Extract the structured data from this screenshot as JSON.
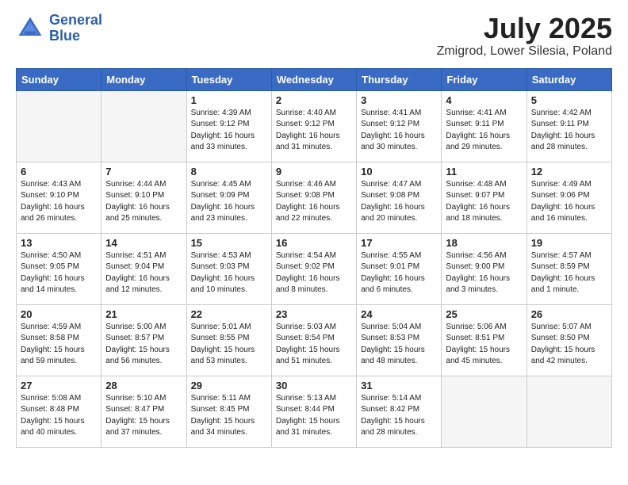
{
  "logo": {
    "text_general": "General",
    "text_blue": "Blue"
  },
  "title": "July 2025",
  "location": "Zmigrod, Lower Silesia, Poland",
  "weekdays": [
    "Sunday",
    "Monday",
    "Tuesday",
    "Wednesday",
    "Thursday",
    "Friday",
    "Saturday"
  ],
  "weeks": [
    [
      {
        "day": "",
        "info": ""
      },
      {
        "day": "",
        "info": ""
      },
      {
        "day": "1",
        "info": "Sunrise: 4:39 AM\nSunset: 9:12 PM\nDaylight: 16 hours\nand 33 minutes."
      },
      {
        "day": "2",
        "info": "Sunrise: 4:40 AM\nSunset: 9:12 PM\nDaylight: 16 hours\nand 31 minutes."
      },
      {
        "day": "3",
        "info": "Sunrise: 4:41 AM\nSunset: 9:12 PM\nDaylight: 16 hours\nand 30 minutes."
      },
      {
        "day": "4",
        "info": "Sunrise: 4:41 AM\nSunset: 9:11 PM\nDaylight: 16 hours\nand 29 minutes."
      },
      {
        "day": "5",
        "info": "Sunrise: 4:42 AM\nSunset: 9:11 PM\nDaylight: 16 hours\nand 28 minutes."
      }
    ],
    [
      {
        "day": "6",
        "info": "Sunrise: 4:43 AM\nSunset: 9:10 PM\nDaylight: 16 hours\nand 26 minutes."
      },
      {
        "day": "7",
        "info": "Sunrise: 4:44 AM\nSunset: 9:10 PM\nDaylight: 16 hours\nand 25 minutes."
      },
      {
        "day": "8",
        "info": "Sunrise: 4:45 AM\nSunset: 9:09 PM\nDaylight: 16 hours\nand 23 minutes."
      },
      {
        "day": "9",
        "info": "Sunrise: 4:46 AM\nSunset: 9:08 PM\nDaylight: 16 hours\nand 22 minutes."
      },
      {
        "day": "10",
        "info": "Sunrise: 4:47 AM\nSunset: 9:08 PM\nDaylight: 16 hours\nand 20 minutes."
      },
      {
        "day": "11",
        "info": "Sunrise: 4:48 AM\nSunset: 9:07 PM\nDaylight: 16 hours\nand 18 minutes."
      },
      {
        "day": "12",
        "info": "Sunrise: 4:49 AM\nSunset: 9:06 PM\nDaylight: 16 hours\nand 16 minutes."
      }
    ],
    [
      {
        "day": "13",
        "info": "Sunrise: 4:50 AM\nSunset: 9:05 PM\nDaylight: 16 hours\nand 14 minutes."
      },
      {
        "day": "14",
        "info": "Sunrise: 4:51 AM\nSunset: 9:04 PM\nDaylight: 16 hours\nand 12 minutes."
      },
      {
        "day": "15",
        "info": "Sunrise: 4:53 AM\nSunset: 9:03 PM\nDaylight: 16 hours\nand 10 minutes."
      },
      {
        "day": "16",
        "info": "Sunrise: 4:54 AM\nSunset: 9:02 PM\nDaylight: 16 hours\nand 8 minutes."
      },
      {
        "day": "17",
        "info": "Sunrise: 4:55 AM\nSunset: 9:01 PM\nDaylight: 16 hours\nand 6 minutes."
      },
      {
        "day": "18",
        "info": "Sunrise: 4:56 AM\nSunset: 9:00 PM\nDaylight: 16 hours\nand 3 minutes."
      },
      {
        "day": "19",
        "info": "Sunrise: 4:57 AM\nSunset: 8:59 PM\nDaylight: 16 hours\nand 1 minute."
      }
    ],
    [
      {
        "day": "20",
        "info": "Sunrise: 4:59 AM\nSunset: 8:58 PM\nDaylight: 15 hours\nand 59 minutes."
      },
      {
        "day": "21",
        "info": "Sunrise: 5:00 AM\nSunset: 8:57 PM\nDaylight: 15 hours\nand 56 minutes."
      },
      {
        "day": "22",
        "info": "Sunrise: 5:01 AM\nSunset: 8:55 PM\nDaylight: 15 hours\nand 53 minutes."
      },
      {
        "day": "23",
        "info": "Sunrise: 5:03 AM\nSunset: 8:54 PM\nDaylight: 15 hours\nand 51 minutes."
      },
      {
        "day": "24",
        "info": "Sunrise: 5:04 AM\nSunset: 8:53 PM\nDaylight: 15 hours\nand 48 minutes."
      },
      {
        "day": "25",
        "info": "Sunrise: 5:06 AM\nSunset: 8:51 PM\nDaylight: 15 hours\nand 45 minutes."
      },
      {
        "day": "26",
        "info": "Sunrise: 5:07 AM\nSunset: 8:50 PM\nDaylight: 15 hours\nand 42 minutes."
      }
    ],
    [
      {
        "day": "27",
        "info": "Sunrise: 5:08 AM\nSunset: 8:48 PM\nDaylight: 15 hours\nand 40 minutes."
      },
      {
        "day": "28",
        "info": "Sunrise: 5:10 AM\nSunset: 8:47 PM\nDaylight: 15 hours\nand 37 minutes."
      },
      {
        "day": "29",
        "info": "Sunrise: 5:11 AM\nSunset: 8:45 PM\nDaylight: 15 hours\nand 34 minutes."
      },
      {
        "day": "30",
        "info": "Sunrise: 5:13 AM\nSunset: 8:44 PM\nDaylight: 15 hours\nand 31 minutes."
      },
      {
        "day": "31",
        "info": "Sunrise: 5:14 AM\nSunset: 8:42 PM\nDaylight: 15 hours\nand 28 minutes."
      },
      {
        "day": "",
        "info": ""
      },
      {
        "day": "",
        "info": ""
      }
    ]
  ]
}
